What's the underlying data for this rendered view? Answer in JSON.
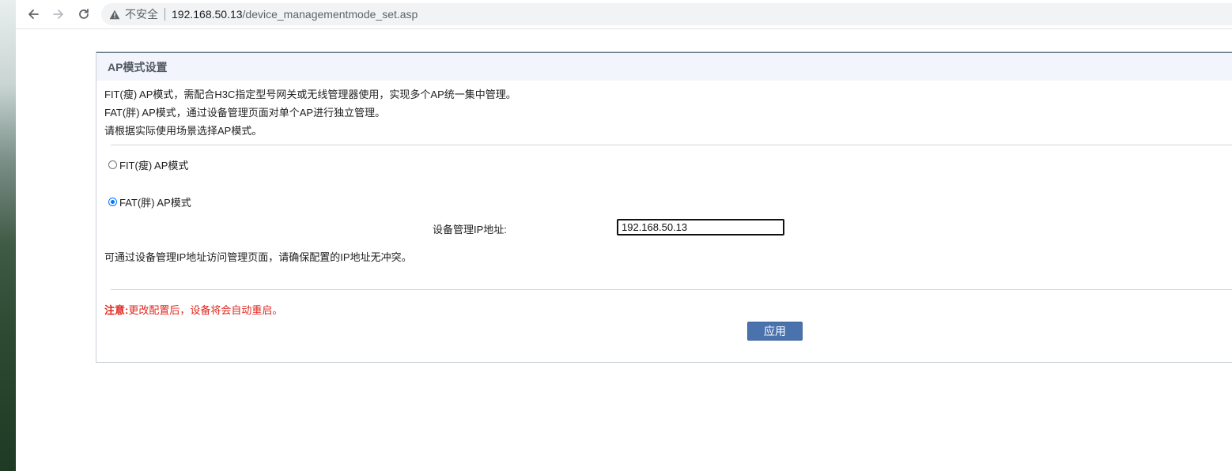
{
  "browser": {
    "security_label": "不安全",
    "url_host": "192.168.50.13",
    "url_path": "/device_managementmode_set.asp"
  },
  "panel": {
    "title": "AP模式设置",
    "description": [
      "FIT(瘦) AP模式，需配合H3C指定型号网关或无线管理器使用，实现多个AP统一集中管理。",
      "FAT(胖) AP模式，通过设备管理页面对单个AP进行独立管理。",
      "请根据实际使用场景选择AP模式。"
    ],
    "modes": [
      {
        "label": "FIT(瘦) AP模式",
        "selected": false
      },
      {
        "label": "FAT(胖) AP模式",
        "selected": true
      }
    ],
    "ip_label": "设备管理IP地址:",
    "ip_value": "192.168.50.13",
    "ip_hint": "可通过设备管理IP地址访问管理页面，请确保配置的IP地址无冲突。",
    "notice_prefix": "注意:",
    "notice_text": "更改配置后，设备将会自动重启。",
    "apply_label": "应用"
  },
  "colors": {
    "accent_button": "#4a72ad",
    "notice_red": "#e0261f",
    "radio_selected": "#0075ff"
  }
}
